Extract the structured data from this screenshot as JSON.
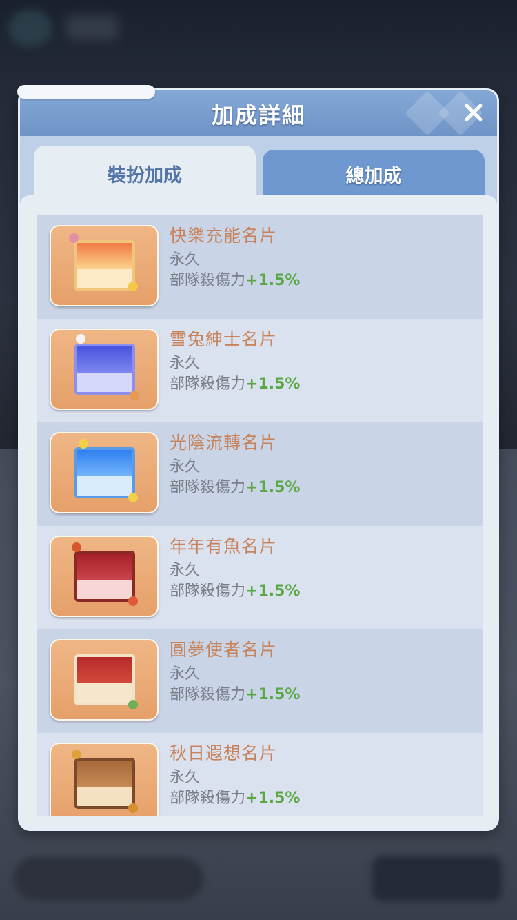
{
  "dialog": {
    "title": "加成詳細",
    "tabs": [
      {
        "label": "裝扮加成",
        "active": true
      },
      {
        "label": "總加成",
        "active": false
      }
    ]
  },
  "items": [
    {
      "name": "快樂充能名片",
      "duration": "永久",
      "effect_label": "部隊殺傷力",
      "effect_value": "+1.5%"
    },
    {
      "name": "雪兔紳士名片",
      "duration": "永久",
      "effect_label": "部隊殺傷力",
      "effect_value": "+1.5%"
    },
    {
      "name": "光陰流轉名片",
      "duration": "永久",
      "effect_label": "部隊殺傷力",
      "effect_value": "+1.5%"
    },
    {
      "name": "年年有魚名片",
      "duration": "永久",
      "effect_label": "部隊殺傷力",
      "effect_value": "+1.5%"
    },
    {
      "name": "圓夢使者名片",
      "duration": "永久",
      "effect_label": "部隊殺傷力",
      "effect_value": "+1.5%"
    },
    {
      "name": "秋日遐想名片",
      "duration": "永久",
      "effect_label": "部隊殺傷力",
      "effect_value": "+1.5%"
    }
  ],
  "colors": {
    "name_text": "#c8825a",
    "value_text": "#5aa844",
    "header": "#7a9fd0"
  }
}
